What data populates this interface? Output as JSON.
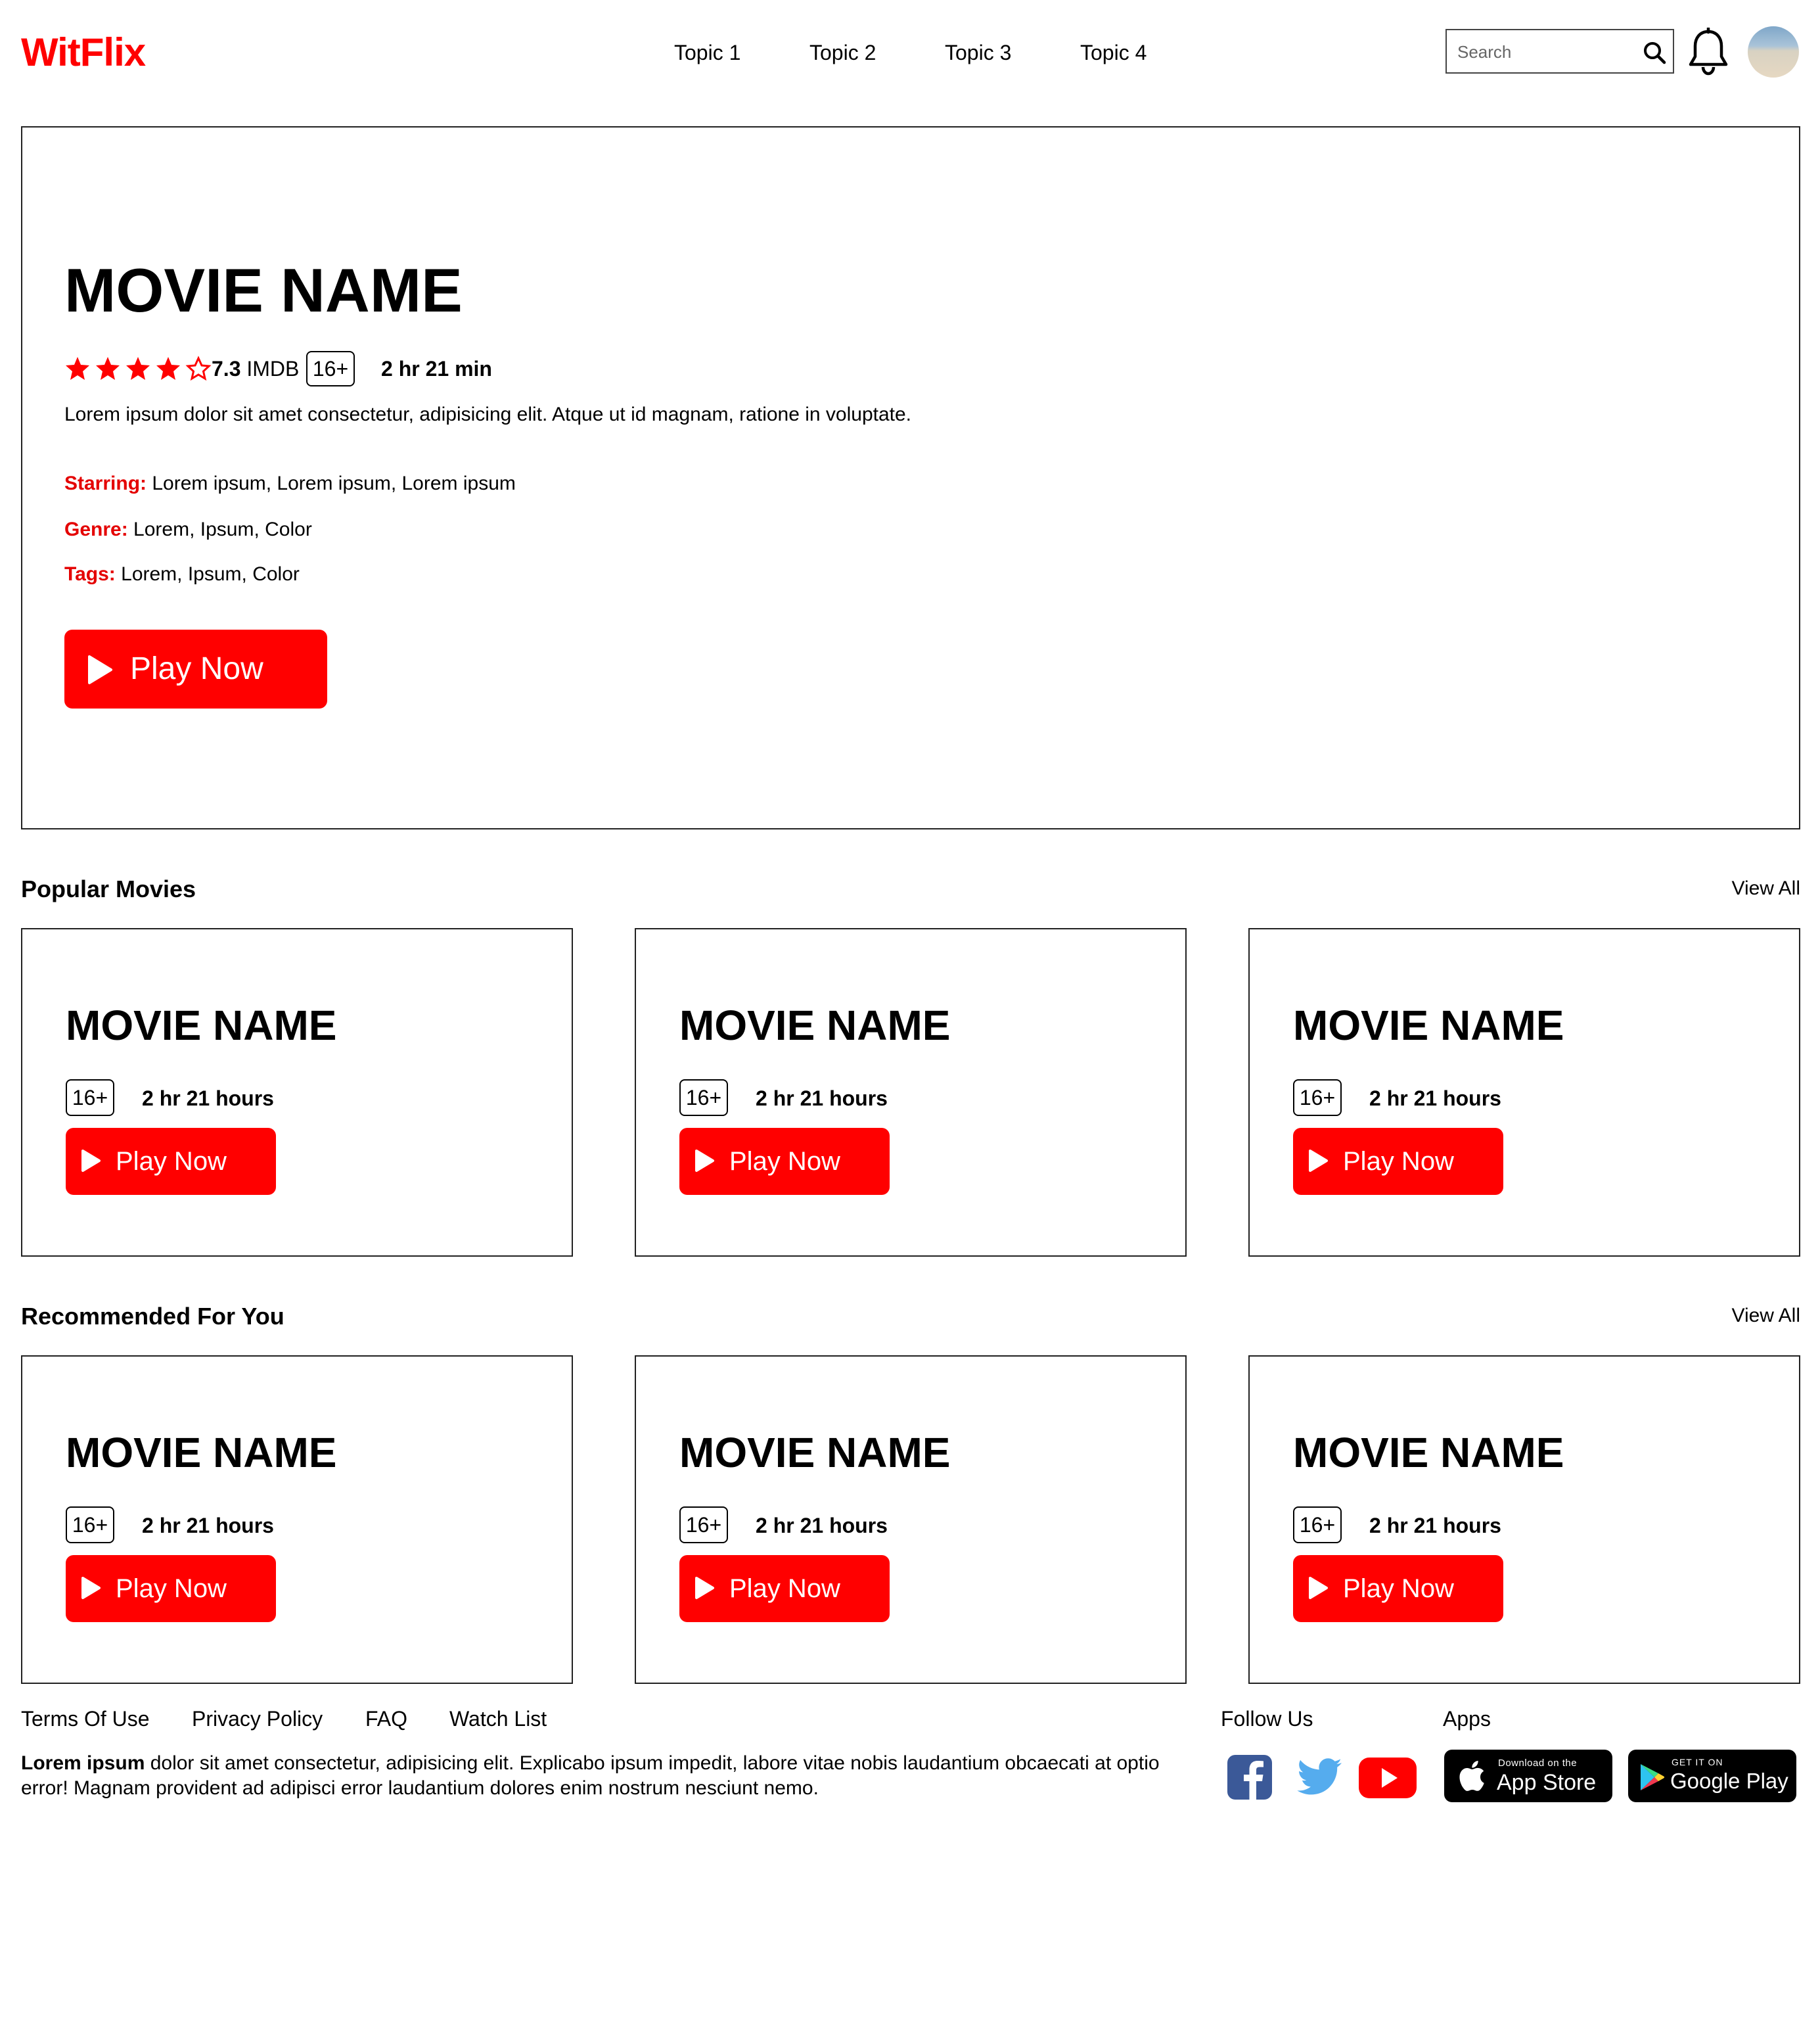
{
  "header": {
    "logo": "WitFlix",
    "nav": [
      "Topic 1",
      "Topic 2",
      "Topic 3",
      "Topic 4"
    ],
    "search_placeholder": "Search"
  },
  "hero": {
    "title": "MOVIE NAME",
    "stars_filled": 4,
    "stars_total": 5,
    "imdb_score": "7.3",
    "imdb_label": "IMDB",
    "age_rating": "16+",
    "duration": "2 hr 21 min",
    "description": "Lorem ipsum dolor sit amet consectetur, adipisicing elit. Atque ut id magnam, ratione in voluptate.",
    "starring_label": "Starring:",
    "starring": "Lorem ipsum, Lorem ipsum, Lorem ipsum",
    "genre_label": "Genre:",
    "genre": "Lorem, Ipsum, Color",
    "tags_label": "Tags:",
    "tags": "Lorem, Ipsum, Color",
    "play_label": "Play Now"
  },
  "popular": {
    "title": "Popular Movies",
    "view_all": "View All",
    "cards": [
      {
        "title": "MOVIE NAME",
        "age": "16+",
        "duration": "2 hr 21 hours",
        "play": "Play Now"
      },
      {
        "title": "MOVIE NAME",
        "age": "16+",
        "duration": "2 hr 21 hours",
        "play": "Play Now"
      },
      {
        "title": "MOVIE NAME",
        "age": "16+",
        "duration": "2 hr 21 hours",
        "play": "Play Now"
      }
    ]
  },
  "recommended": {
    "title": "Recommended For You",
    "view_all": "View All",
    "cards": [
      {
        "title": "MOVIE NAME",
        "age": "16+",
        "duration": "2 hr 21 hours",
        "play": "Play Now"
      },
      {
        "title": "MOVIE NAME",
        "age": "16+",
        "duration": "2 hr 21 hours",
        "play": "Play Now"
      },
      {
        "title": "MOVIE NAME",
        "age": "16+",
        "duration": "2 hr 21 hours",
        "play": "Play Now"
      }
    ]
  },
  "footer": {
    "links": [
      "Terms Of Use",
      "Privacy Policy",
      "FAQ",
      "Watch List"
    ],
    "text_bold": "Lorem ipsum",
    "text": " dolor sit amet consectetur, adipisicing elit. Explicabo ipsum impedit, labore vitae nobis laudantium obcaecati at optio error! Magnam provident ad adipisci error laudantium dolores enim nostrum nesciunt nemo.",
    "follow_us": "Follow Us",
    "apps": "Apps",
    "social_icons": [
      "facebook-icon",
      "twitter-icon",
      "youtube-icon"
    ],
    "app_store_small": "Download on the",
    "app_store_big": "App Store",
    "google_play_small": "GET IT ON",
    "google_play_big": "Google Play"
  },
  "colors": {
    "brand": "#ff0000",
    "label_red": "#e40000",
    "facebook": "#3b5998",
    "twitter": "#55acee",
    "youtube": "#ff0000"
  }
}
